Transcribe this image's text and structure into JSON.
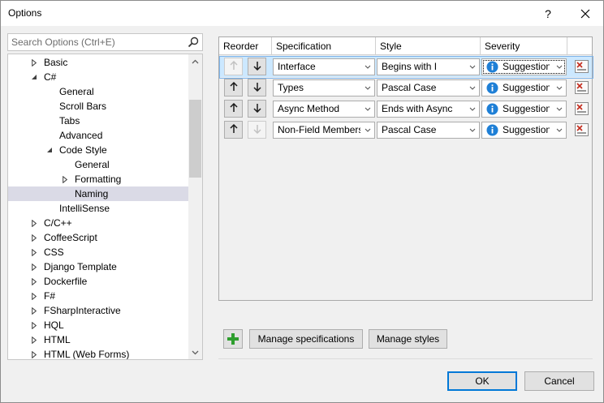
{
  "window": {
    "title": "Options",
    "help": "?",
    "close": "✕"
  },
  "search": {
    "placeholder": "Search Options (Ctrl+E)"
  },
  "tree": {
    "items": [
      {
        "label": "Basic",
        "arrow": "right"
      },
      {
        "label": "C#",
        "arrow": "down"
      },
      {
        "label": "General",
        "arrow": "none"
      },
      {
        "label": "Scroll Bars",
        "arrow": "none"
      },
      {
        "label": "Tabs",
        "arrow": "none"
      },
      {
        "label": "Advanced",
        "arrow": "none"
      },
      {
        "label": "Code Style",
        "arrow": "down"
      },
      {
        "label": "General",
        "arrow": "none"
      },
      {
        "label": "Formatting",
        "arrow": "right"
      },
      {
        "label": "Naming",
        "arrow": "none",
        "selected": true
      },
      {
        "label": "IntelliSense",
        "arrow": "none"
      },
      {
        "label": "C/C++",
        "arrow": "right"
      },
      {
        "label": "CoffeeScript",
        "arrow": "right"
      },
      {
        "label": "CSS",
        "arrow": "right"
      },
      {
        "label": "Django Template",
        "arrow": "right"
      },
      {
        "label": "Dockerfile",
        "arrow": "right"
      },
      {
        "label": "F#",
        "arrow": "right"
      },
      {
        "label": "FSharpInteractive",
        "arrow": "right"
      },
      {
        "label": "HQL",
        "arrow": "right"
      },
      {
        "label": "HTML",
        "arrow": "right"
      },
      {
        "label": "HTML (Web Forms)",
        "arrow": "right"
      }
    ]
  },
  "grid": {
    "headers": [
      "Reorder",
      "Specification",
      "Style",
      "Severity"
    ],
    "rows": [
      {
        "specification": "Interface",
        "style": "Begins with I",
        "severity": "Suggestion",
        "up_enabled": false,
        "down_enabled": true,
        "selected": true
      },
      {
        "specification": "Types",
        "style": "Pascal Case",
        "severity": "Suggestion",
        "up_enabled": true,
        "down_enabled": true,
        "selected": false
      },
      {
        "specification": "Async Method",
        "style": "Ends with Async",
        "severity": "Suggestion",
        "up_enabled": true,
        "down_enabled": true,
        "selected": false
      },
      {
        "specification": "Non-Field Members",
        "style": "Pascal Case",
        "severity": "Suggestion",
        "up_enabled": true,
        "down_enabled": false,
        "selected": false
      }
    ]
  },
  "actions": {
    "manage_specifications": "Manage specifications",
    "manage_styles": "Manage styles"
  },
  "footer": {
    "ok": "OK",
    "cancel": "Cancel"
  },
  "colors": {
    "accent": "#0078d7",
    "info": "#1e7fd6",
    "add": "#2e9e2e",
    "delete": "#c42b1c",
    "selection": "#cce8ff"
  }
}
